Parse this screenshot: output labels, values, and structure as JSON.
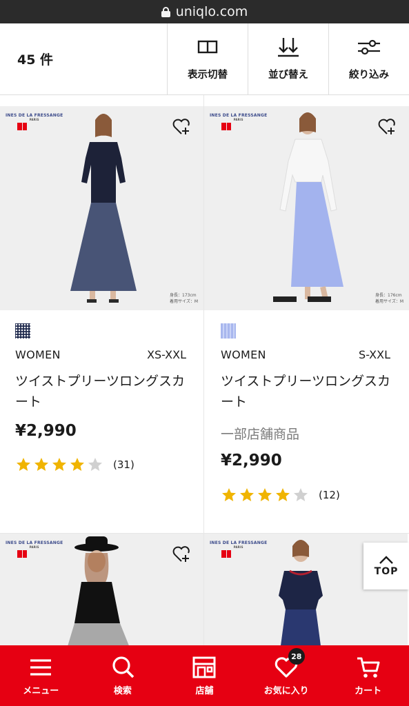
{
  "browser": {
    "url": "uniqlo.com",
    "lock_icon": "lock-icon"
  },
  "toolbar": {
    "count": "45 件",
    "display_toggle_label": "表示切替",
    "sort_label": "並び替え",
    "filter_label": "絞り込み"
  },
  "products": [
    {
      "brand": "INES DE LA FRESSANGE",
      "brand_sub": "PARIS",
      "photo_note_1": "身長：173cm",
      "photo_note_2": "着用サイズ：M",
      "swatch_color": "#1f2a4d",
      "gender": "WOMEN",
      "size": "XS-XXL",
      "name": "ツイストプリーツロングスカート",
      "note": "",
      "price": "¥2,990",
      "rating": 4,
      "reviews": "(31)"
    },
    {
      "brand": "INES DE LA FRESSANGE",
      "brand_sub": "PARIS",
      "photo_note_1": "身長：176cm",
      "photo_note_2": "着用サイズ：M",
      "swatch_color": "#a8b7ee",
      "gender": "WOMEN",
      "size": "S-XXL",
      "name": "ツイストプリーツロングスカート",
      "note": "一部店舗商品",
      "price": "¥2,990",
      "rating": 4,
      "reviews": "(12)"
    },
    {
      "brand": "INES DE LA FRESSANGE",
      "brand_sub": "PARIS"
    },
    {
      "brand": "INES DE LA FRESSANGE",
      "brand_sub": "PARIS"
    }
  ],
  "top_button": {
    "label": "TOP"
  },
  "bottom_nav": {
    "menu_label": "メニュー",
    "search_label": "検索",
    "store_label": "店舗",
    "favorites_label": "お気に入り",
    "favorites_count": "28",
    "cart_label": "カート"
  },
  "colors": {
    "accent": "#e60012",
    "star": "#f0b400",
    "star_empty": "#d0d0d0"
  }
}
